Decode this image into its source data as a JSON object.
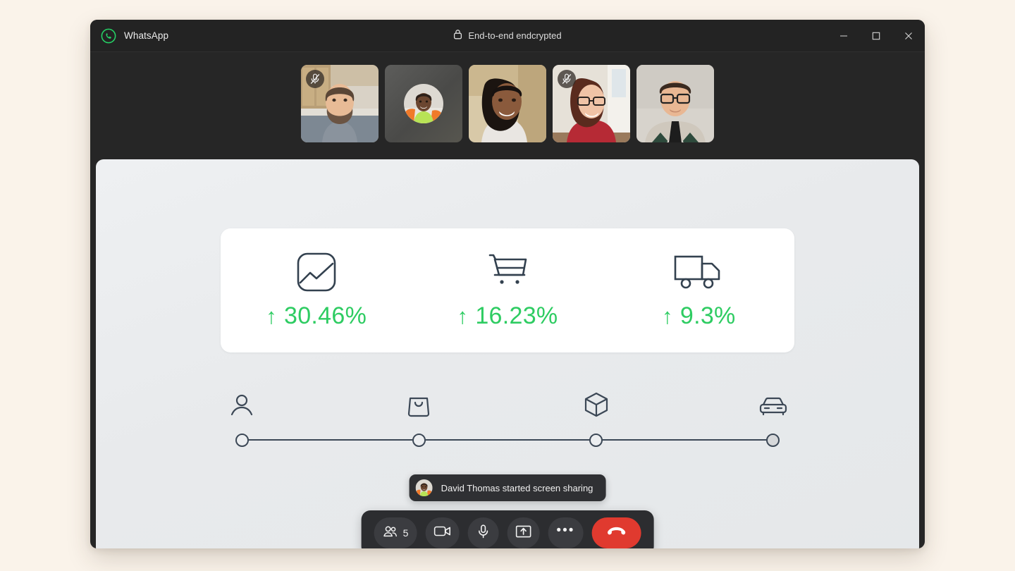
{
  "window": {
    "app_name": "WhatsApp",
    "logo_icon": "whatsapp-logo-icon",
    "encryption_label": "End-to-end endcrypted",
    "lock_icon": "lock-icon",
    "controls": {
      "minimize_label": "Minimize",
      "maximize_label": "Maximize",
      "close_label": "Close"
    },
    "accent_green": "#25D366",
    "titlebar_bg": "#232323"
  },
  "participants_strip": {
    "tiles": [
      {
        "name": "participant-tile-1",
        "muted": true,
        "camera_on": true,
        "kind": "video"
      },
      {
        "name": "participant-tile-2",
        "muted": false,
        "camera_on": false,
        "kind": "avatar"
      },
      {
        "name": "participant-tile-3",
        "muted": false,
        "camera_on": true,
        "kind": "video"
      },
      {
        "name": "participant-tile-4",
        "muted": true,
        "camera_on": true,
        "kind": "video"
      },
      {
        "name": "participant-tile-5",
        "muted": false,
        "camera_on": true,
        "kind": "video"
      }
    ],
    "mute_icon": "mic-off-icon"
  },
  "shared_screen": {
    "kpi_card": {
      "items": [
        {
          "icon": "chart-trend-icon",
          "arrow": "↑",
          "value": "30.46%"
        },
        {
          "icon": "shopping-cart-icon",
          "arrow": "↑",
          "value": "16.23%"
        },
        {
          "icon": "delivery-truck-icon",
          "arrow": "↑",
          "value": "9.3%"
        }
      ],
      "value_color": "#2ecc62"
    },
    "stepper": {
      "steps": [
        {
          "icon": "person-icon",
          "filled": false
        },
        {
          "icon": "shopping-bag-icon",
          "filled": false
        },
        {
          "icon": "package-box-icon",
          "filled": false
        },
        {
          "icon": "car-icon",
          "filled": true
        }
      ],
      "line_color": "#3c4856"
    }
  },
  "toast": {
    "avatar_icon": "avatar-icon",
    "message": "David Thomas started screen sharing"
  },
  "control_bar": {
    "participants": {
      "icon": "people-icon",
      "count": "5",
      "label": "Participants"
    },
    "camera": {
      "icon": "video-camera-icon",
      "label": "Camera"
    },
    "microphone": {
      "icon": "microphone-icon",
      "label": "Microphone"
    },
    "share_screen": {
      "icon": "share-screen-icon",
      "label": "Share screen"
    },
    "more": {
      "icon": "more-dots-icon",
      "label": "More options"
    },
    "end_call": {
      "icon": "end-call-icon",
      "label": "End call",
      "color": "#e03a2f"
    }
  }
}
